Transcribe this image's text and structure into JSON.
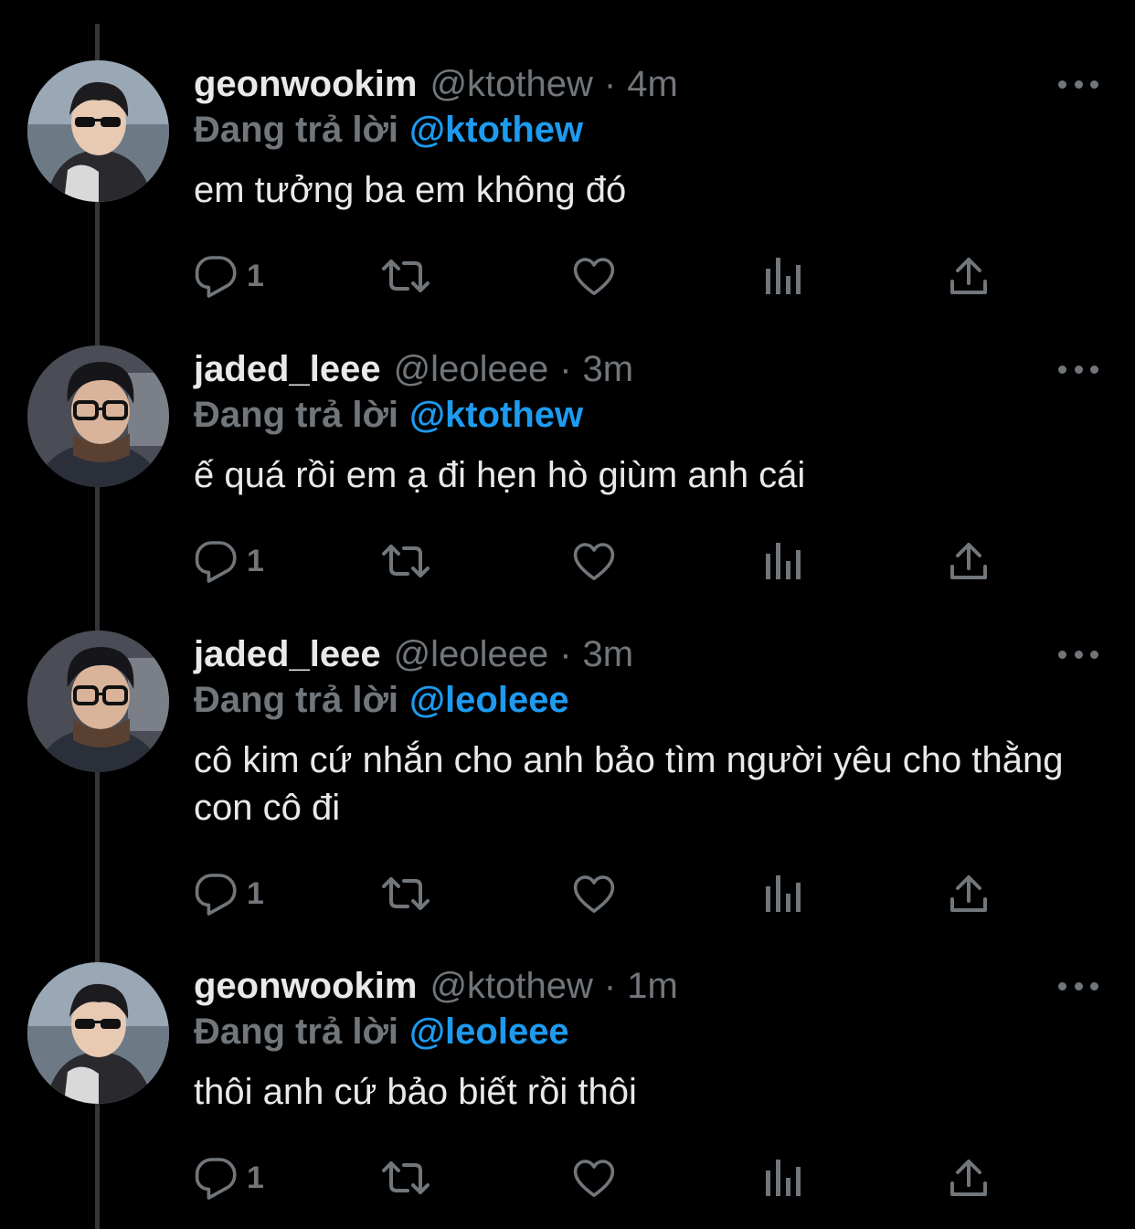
{
  "colors": {
    "background": "#000000",
    "text": "#e7e9ea",
    "muted": "#71767b",
    "mention": "#1d9bf0",
    "thread_line": "#333639"
  },
  "tweets": [
    {
      "display_name": "geonwookim",
      "handle": "@ktothew",
      "separator": "·",
      "time": "4m",
      "reply_prefix": "Đang trả lời",
      "reply_to": "@ktothew",
      "text": "em tưởng ba em không đó",
      "reply_count": "1",
      "avatar_icon": "avatar-sunglasses-icon"
    },
    {
      "display_name": "jaded_leee",
      "handle": "@leoleee",
      "separator": "·",
      "time": "3m",
      "reply_prefix": "Đang trả lời",
      "reply_to": "@ktothew",
      "text": "ế quá rồi em ạ đi hẹn hò giùm anh cái",
      "reply_count": "1",
      "avatar_icon": "avatar-glasses-icon"
    },
    {
      "display_name": "jaded_leee",
      "handle": "@leoleee",
      "separator": "·",
      "time": "3m",
      "reply_prefix": "Đang trả lời",
      "reply_to": "@leoleee",
      "text": "cô kim cứ nhắn cho anh bảo tìm người yêu cho thằng con cô đi",
      "reply_count": "1",
      "avatar_icon": "avatar-glasses-icon"
    },
    {
      "display_name": "geonwookim",
      "handle": "@ktothew",
      "separator": "·",
      "time": "1m",
      "reply_prefix": "Đang trả lời",
      "reply_to": "@leoleee",
      "text": "thôi anh cứ bảo biết rồi thôi",
      "reply_count": "1",
      "avatar_icon": "avatar-sunglasses-icon"
    }
  ],
  "action_icons": [
    "reply-icon",
    "retweet-icon",
    "like-icon",
    "analytics-icon",
    "share-icon"
  ]
}
